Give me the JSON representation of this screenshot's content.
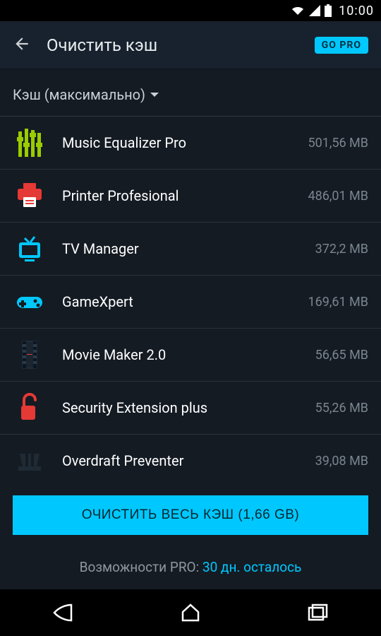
{
  "statusbar": {
    "time": "10:00"
  },
  "header": {
    "title": "Очистить кэш",
    "gopro": "GO PRO"
  },
  "sort": {
    "label": "Кэш (максимально)"
  },
  "apps": [
    {
      "name": "Music Equalizer Pro",
      "size": "501,56 MB"
    },
    {
      "name": "Printer Profesional",
      "size": "486,01 MB"
    },
    {
      "name": "TV Manager",
      "size": "372,2 MB"
    },
    {
      "name": "GameXpert",
      "size": "169,61 MB"
    },
    {
      "name": "Movie Maker 2.0",
      "size": "56,65 MB"
    },
    {
      "name": "Security Extension plus",
      "size": "55,26 MB"
    },
    {
      "name": "Overdraft Preventer",
      "size": "39,08 MB"
    }
  ],
  "clear_button": "ОЧИСТИТЬ ВЕСЬ КЭШ (1,66 GB)",
  "pro_footer": {
    "prefix": "Возможности PRO: ",
    "highlight": "30 дн. осталось"
  }
}
